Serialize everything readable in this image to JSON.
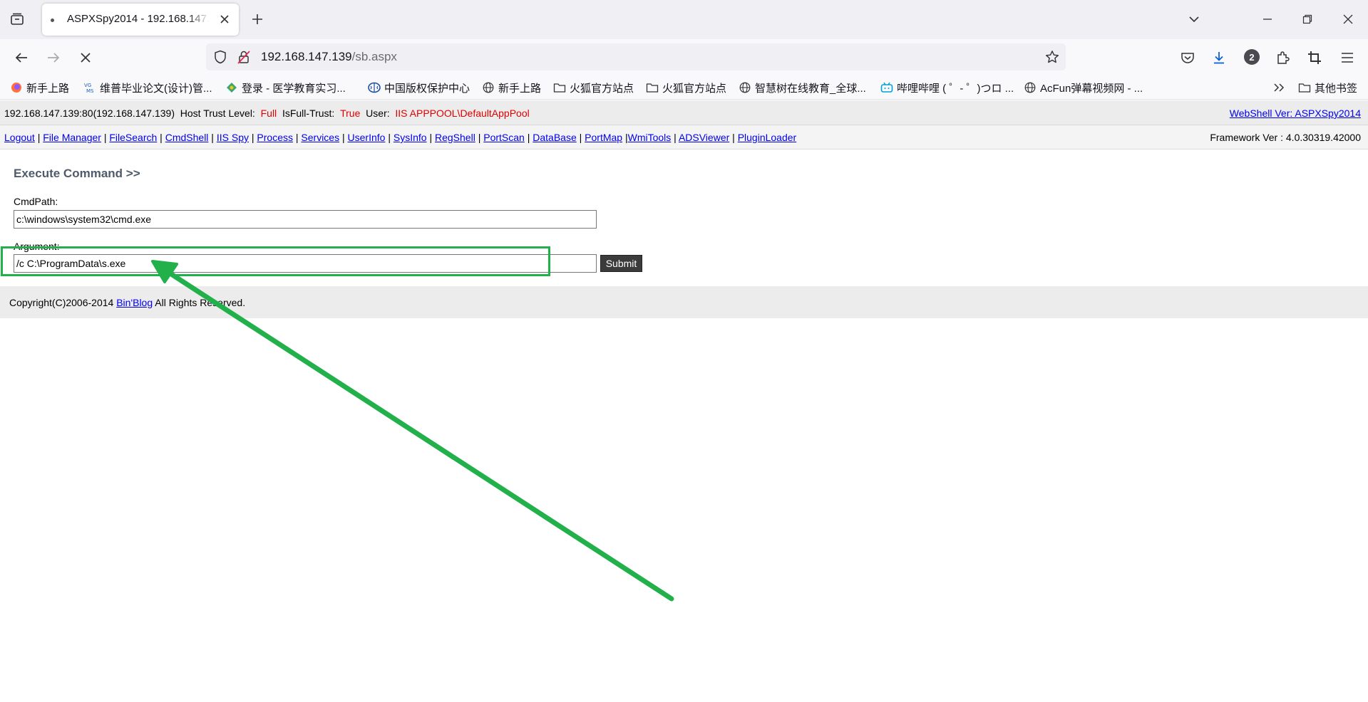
{
  "browser": {
    "tab_title": "ASPXSpy2014 - 192.168.147.139/sb.aspx",
    "url_host": "192.168.147.139",
    "url_path": "/sb.aspx",
    "extension_badge": "2",
    "bookmarks": [
      {
        "label": "新手上路",
        "icon": "firefox-icon"
      },
      {
        "label": "维普毕业论文(设计)管...",
        "icon": "vgms-icon"
      },
      {
        "label": "登录 - 医学教育实习...",
        "icon": "puzzle-icon"
      },
      {
        "label": "中国版权保护中心",
        "icon": "brain-icon"
      },
      {
        "label": "新手上路",
        "icon": "globe-icon"
      },
      {
        "label": "火狐官方站点",
        "icon": "folder-icon"
      },
      {
        "label": "火狐官方站点",
        "icon": "folder-icon"
      },
      {
        "label": "智慧树在线教育_全球...",
        "icon": "globe-icon"
      },
      {
        "label": "哔哩哔哩 ( ゜- ゜)つロ ...",
        "icon": "bilibili-icon"
      },
      {
        "label": "AcFun弹幕视频网 - ...",
        "icon": "globe-icon"
      }
    ],
    "other_bookmarks": "其他书签"
  },
  "infobar": {
    "host": "192.168.147.139:80(192.168.147.139)",
    "trust_label": "Host Trust Level:",
    "trust_value": "Full",
    "fulltrust_label": "IsFull-Trust:",
    "fulltrust_value": "True",
    "user_label": "User:",
    "user_value": "IIS APPPOOL\\DefaultAppPool",
    "version_link": "WebShell Ver: ASPXSpy2014"
  },
  "menu": {
    "items": [
      "Logout",
      "File Manager",
      "FileSearch",
      "CmdShell",
      "IIS Spy",
      "Process",
      "Services",
      "UserInfo",
      "SysInfo",
      "RegShell",
      "PortScan",
      "DataBase",
      "PortMap",
      "WmiTools",
      "ADSViewer",
      "PluginLoader"
    ],
    "framework": "Framework Ver : 4.0.30319.42000"
  },
  "main": {
    "title": "Execute Command >>",
    "cmdpath_label": "CmdPath:",
    "cmdpath_value": "c:\\windows\\system32\\cmd.exe",
    "argument_label": "Argument:",
    "argument_value": "/c C:\\ProgramData\\s.exe",
    "submit_label": "Submit"
  },
  "footer": {
    "prefix": "Copyright(C)2006-2014 ",
    "link": "Bin'Blog",
    "suffix": " All Rights Reserved."
  },
  "colors": {
    "annotation": "#22b04b",
    "warning_text": "#e00000",
    "link": "#0000ee"
  }
}
